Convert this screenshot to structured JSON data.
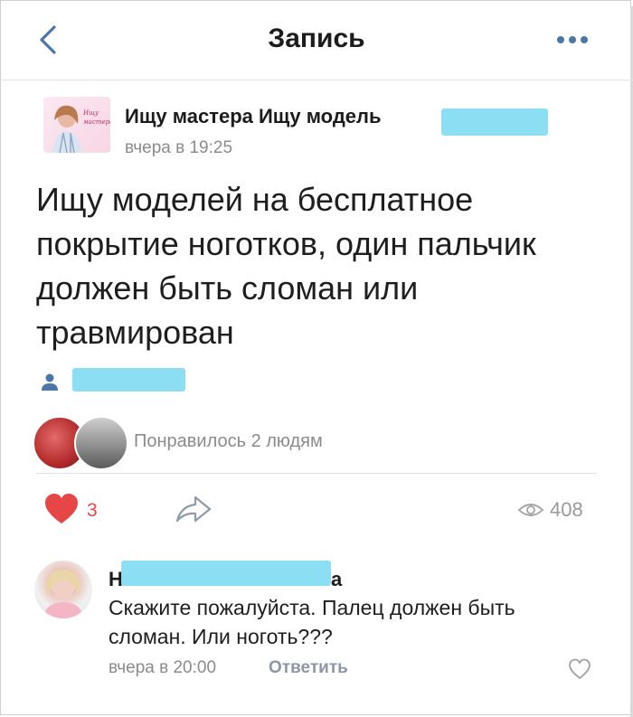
{
  "header": {
    "title": "Запись"
  },
  "post": {
    "author_name": "Ищу мастера Ищу модель",
    "author_name_tail": "",
    "time": "вчера в 19:25",
    "text": "Ищу моделей на бесплатное покрытие ноготков, один пальчик должен быть сломан или травмирован",
    "liked_text": "Понравилось 2 людям",
    "likes_count": "3",
    "views": "408"
  },
  "comment": {
    "name_first_letter": "Н",
    "name_last_letter": "а",
    "text": "Скажите пожалуйста. Палец должен быть сломан. Или ноготь???",
    "time": "вчера в 20:00",
    "reply_label": "Ответить"
  },
  "colors": {
    "accent": "#4a76a8",
    "like": "#e64646",
    "redaction": "#7fdcf2"
  },
  "icons": {
    "back": "chevron-left-icon",
    "more": "ellipsis-icon",
    "user": "user-icon",
    "heart": "heart-icon",
    "share": "share-icon",
    "views": "eye-icon"
  }
}
